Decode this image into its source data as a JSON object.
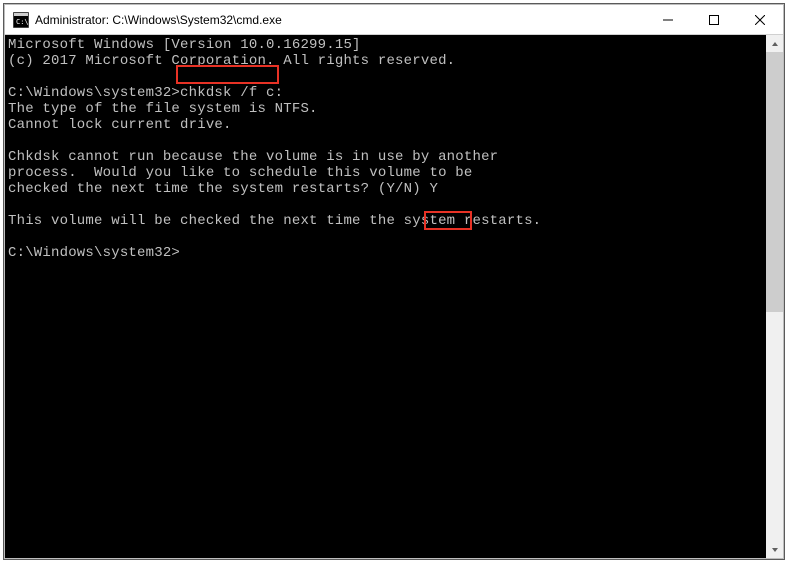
{
  "titlebar": {
    "title": "Administrator: C:\\Windows\\System32\\cmd.exe"
  },
  "terminal": {
    "line1": "Microsoft Windows [Version 10.0.16299.15]",
    "line2": "(c) 2017 Microsoft Corporation. All rights reserved.",
    "blank1": "",
    "promptLine": "C:\\Windows\\system32>chkdsk /f c:",
    "line4": "The type of the file system is NTFS.",
    "line5": "Cannot lock current drive.",
    "blank2": "",
    "line6": "Chkdsk cannot run because the volume is in use by another",
    "line7": "process.  Would you like to schedule this volume to be",
    "line8": "checked the next time the system restarts? (Y/N) Y",
    "blank3": "",
    "line9": "This volume will be checked the next time the system restarts.",
    "blank4": "",
    "promptFinal": "C:\\Windows\\system32>"
  }
}
